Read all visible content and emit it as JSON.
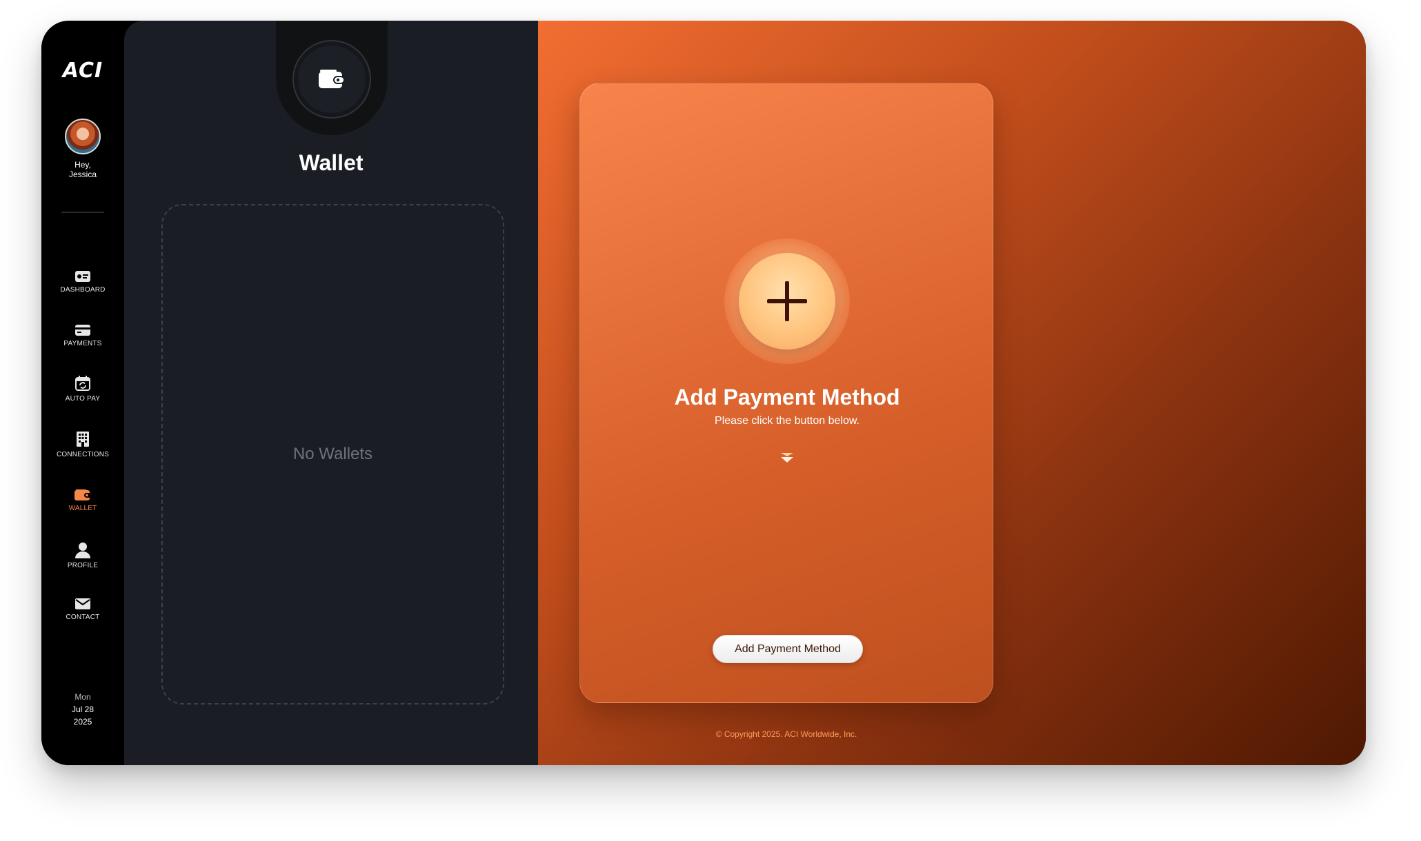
{
  "app": {
    "logo_text": "ACI",
    "greeting_line1": "Hey,",
    "greeting_line2": "Jessica"
  },
  "nav": {
    "items": [
      {
        "label": "DASHBOARD",
        "icon": "dashboard-card-icon",
        "active": false
      },
      {
        "label": "PAYMENTS",
        "icon": "credit-card-icon",
        "active": false
      },
      {
        "label": "AUTO PAY",
        "icon": "calendar-refresh-icon",
        "active": false
      },
      {
        "label": "CONNECTIONS",
        "icon": "building-icon",
        "active": false
      },
      {
        "label": "WALLET",
        "icon": "wallet-icon",
        "active": true
      },
      {
        "label": "PROFILE",
        "icon": "user-icon",
        "active": false
      },
      {
        "label": "CONTACT",
        "icon": "envelope-icon",
        "active": false
      }
    ]
  },
  "date": {
    "day": "Mon",
    "month_day": "Jul 28",
    "year": "2025"
  },
  "wallet": {
    "title": "Wallet",
    "empty_text": "No Wallets",
    "badge_icon": "wallet-icon"
  },
  "add_card": {
    "title": "Add Payment Method",
    "subtitle": "Please click the button below.",
    "button_label": "Add Payment Method",
    "plus_icon": "plus-icon",
    "chevron_icon": "double-chevron-down-icon"
  },
  "footer": {
    "copyright": "© Copyright 2025. ACI Worldwide, Inc."
  },
  "colors": {
    "accent": "#f5874b",
    "panel_dark": "#1a1d23",
    "rail": "#000000",
    "orange_start": "#f26e32",
    "orange_end": "#4e1802",
    "button_text": "#3a1606"
  }
}
